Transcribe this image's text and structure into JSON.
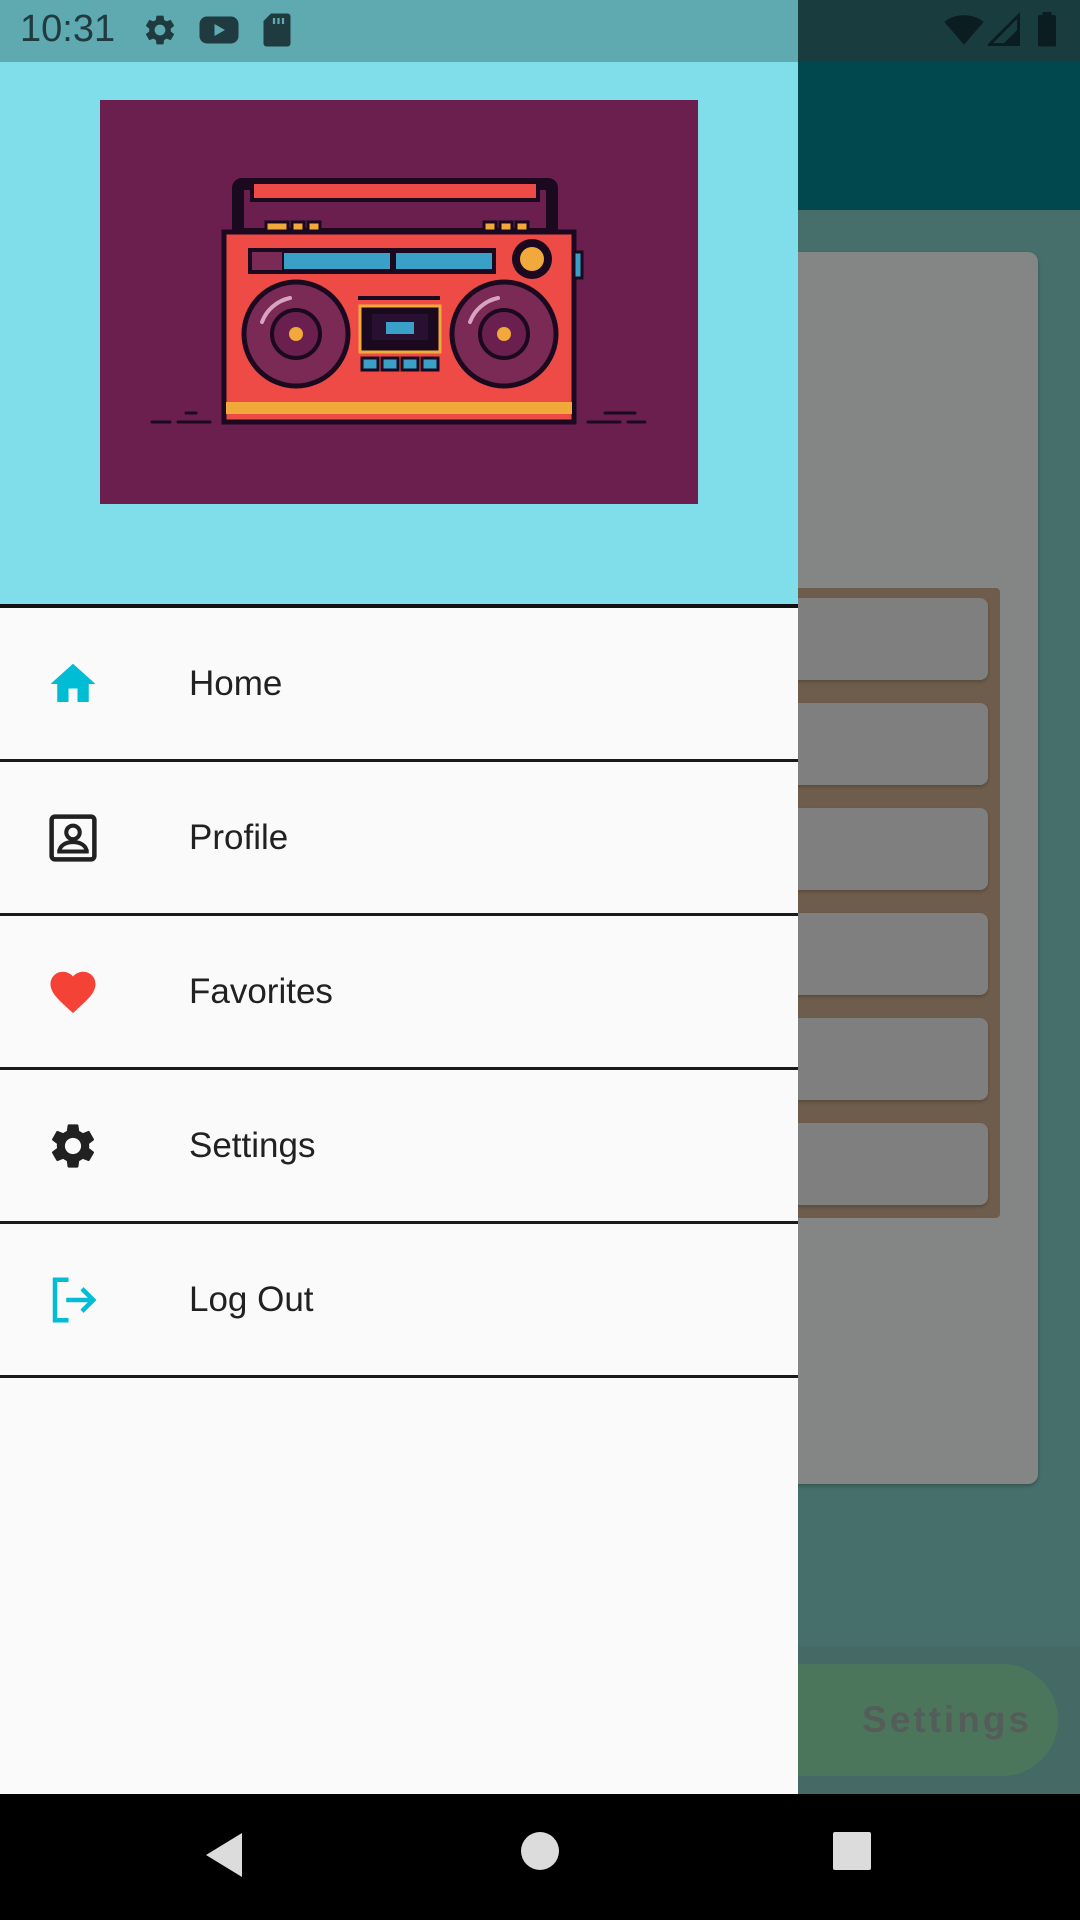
{
  "status_bar": {
    "time": "10:31",
    "left_icons": [
      "gear-icon",
      "youtube-icon",
      "sd-card-icon"
    ],
    "right_icons": [
      "wifi-icon",
      "signal-icon",
      "battery-icon"
    ]
  },
  "drawer": {
    "header_image": "boombox-illustration",
    "items": [
      {
        "label": "Home",
        "icon": "home-icon",
        "icon_color": "#00bcd4"
      },
      {
        "label": "Profile",
        "icon": "contact-card-icon",
        "icon_color": "#212121"
      },
      {
        "label": "Favorites",
        "icon": "heart-icon",
        "icon_color": "#f44336"
      },
      {
        "label": "Settings",
        "icon": "gear-icon",
        "icon_color": "#212121"
      },
      {
        "label": "Log Out",
        "icon": "logout-icon",
        "icon_color": "#00bcd4"
      }
    ]
  },
  "background_app": {
    "bottom_button_label": "Settings"
  },
  "nav_bar": {
    "buttons": [
      "back-icon",
      "home-circle-icon",
      "recents-icon"
    ]
  },
  "colors": {
    "drawer_header": "#80deea",
    "image_bg": "#6b1f4e",
    "accent": "#00bcd4",
    "favorite": "#f44336"
  }
}
